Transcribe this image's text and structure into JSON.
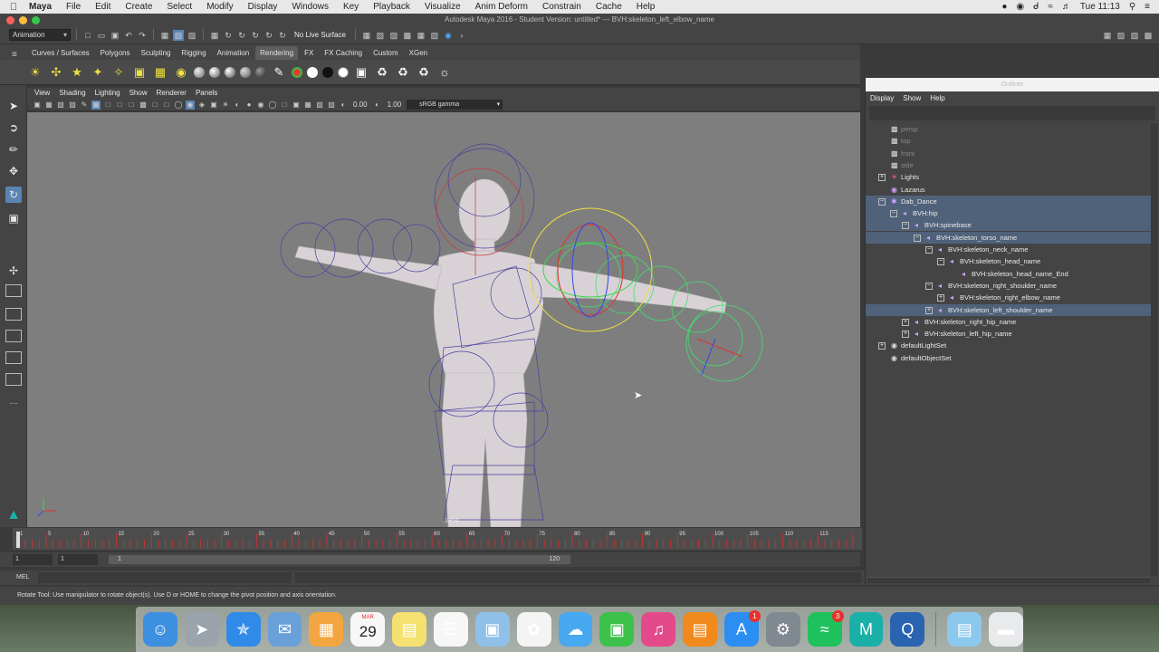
{
  "macbar": {
    "app": "Maya",
    "menus": [
      "File",
      "Edit",
      "Create",
      "Select",
      "Modify",
      "Display",
      "Windows",
      "Key",
      "Playback",
      "Visualize",
      "Anim Deform",
      "Constrain",
      "Cache",
      "Help"
    ],
    "clock": "Tue 11:13"
  },
  "window": {
    "title": "Autodesk Maya 2016 - Student Version: untitled*   ---   BVH:skeleton_left_elbow_name"
  },
  "statusline": {
    "menuset": "Animation",
    "live_surface": "No Live Surface"
  },
  "shelf": {
    "tabs": [
      "Curves / Surfaces",
      "Polygons",
      "Sculpting",
      "Rigging",
      "Animation",
      "Rendering",
      "FX",
      "FX Caching",
      "Custom",
      "XGen"
    ],
    "active_tab": "Rendering"
  },
  "viewport": {
    "menus": [
      "View",
      "Shading",
      "Lighting",
      "Show",
      "Renderer",
      "Panels"
    ],
    "exposure": "0.00",
    "gamma": "1.00",
    "color_space": "sRGB gamma",
    "camera_label": "persp"
  },
  "outliner": {
    "title": "Outliner",
    "menus": [
      "Display",
      "Show",
      "Help"
    ],
    "rows": [
      {
        "label": "persp",
        "depth": 0,
        "expander": "",
        "icon": "camera-icon",
        "dim": true,
        "selected": false
      },
      {
        "label": "top",
        "depth": 0,
        "expander": "",
        "icon": "camera-icon",
        "dim": true,
        "selected": false
      },
      {
        "label": "front",
        "depth": 0,
        "expander": "",
        "icon": "camera-icon",
        "dim": true,
        "selected": false
      },
      {
        "label": "side",
        "depth": 0,
        "expander": "",
        "icon": "camera-icon",
        "dim": true,
        "selected": false
      },
      {
        "label": "Lights",
        "depth": 0,
        "expander": "+",
        "icon": "light-icon",
        "dim": false,
        "selected": false
      },
      {
        "label": "Lazarus",
        "depth": 0,
        "expander": "",
        "icon": "mesh-icon",
        "dim": false,
        "selected": false
      },
      {
        "label": "Dab_Dance",
        "depth": 0,
        "expander": "-",
        "icon": "joint-root-icon",
        "dim": false,
        "selected": true
      },
      {
        "label": "BVH:hip",
        "depth": 1,
        "expander": "-",
        "icon": "joint-icon",
        "dim": false,
        "selected": true
      },
      {
        "label": "BVH:spinebase",
        "depth": 2,
        "expander": "-",
        "icon": "joint-icon",
        "dim": false,
        "selected": true
      },
      {
        "label": "BVH:skeleton_torso_name",
        "depth": 3,
        "expander": "-",
        "icon": "joint-icon",
        "dim": false,
        "selected": true
      },
      {
        "label": "BVH:skeleton_neck_name",
        "depth": 4,
        "expander": "-",
        "icon": "joint-icon",
        "dim": false,
        "selected": false
      },
      {
        "label": "BVH:skeleton_head_name",
        "depth": 5,
        "expander": "-",
        "icon": "joint-icon",
        "dim": false,
        "selected": false
      },
      {
        "label": "BVH:skeleton_head_name_End",
        "depth": 6,
        "expander": "",
        "icon": "joint-icon",
        "dim": false,
        "selected": false
      },
      {
        "label": "BVH:skeleton_right_shoulder_name",
        "depth": 4,
        "expander": "-",
        "icon": "joint-icon",
        "dim": false,
        "selected": false
      },
      {
        "label": "BVH:skeleton_right_elbow_name",
        "depth": 5,
        "expander": "+",
        "icon": "joint-icon",
        "dim": false,
        "selected": false
      },
      {
        "label": "BVH:skeleton_left_shoulder_name",
        "depth": 4,
        "expander": "+",
        "icon": "joint-icon",
        "dim": false,
        "selected": true
      },
      {
        "label": "BVH:skeleton_right_hip_name",
        "depth": 2,
        "expander": "+",
        "icon": "joint-icon",
        "dim": false,
        "selected": false
      },
      {
        "label": "BVH:skeleton_left_hip_name",
        "depth": 2,
        "expander": "+",
        "icon": "joint-icon",
        "dim": false,
        "selected": false
      },
      {
        "label": "defaultLightSet",
        "depth": 0,
        "expander": "+",
        "icon": "set-icon",
        "dim": false,
        "selected": false
      },
      {
        "label": "defaultObjectSet",
        "depth": 0,
        "expander": "",
        "icon": "set-icon",
        "dim": false,
        "selected": false
      }
    ]
  },
  "timeline": {
    "ticks": [
      "1",
      "5",
      "10",
      "15",
      "20",
      "25",
      "30",
      "35",
      "40",
      "45",
      "50",
      "55",
      "60",
      "65",
      "70",
      "75",
      "80",
      "85",
      "90",
      "95",
      "100",
      "105",
      "110",
      "115"
    ],
    "range_start": "1",
    "range_inner_start": "1",
    "range_slider_start": "1",
    "range_slider_end": "120"
  },
  "cmdline": {
    "mel": "MEL"
  },
  "helpline": {
    "text": "Rotate Tool: Use manipulator to rotate object(s). Use D or HOME to change the pivot position and axis orientation."
  },
  "dock": {
    "apps": [
      {
        "name": "Finder",
        "icon": "finder-icon",
        "color": "#3d8fe0",
        "badge": ""
      },
      {
        "name": "Launchpad",
        "icon": "rocket-icon",
        "color": "#9ba3ad",
        "badge": ""
      },
      {
        "name": "Safari",
        "icon": "compass-icon",
        "color": "#2f8ae8",
        "badge": ""
      },
      {
        "name": "Mail",
        "icon": "stamp-icon",
        "color": "#6aa0d8",
        "badge": ""
      },
      {
        "name": "Notes",
        "icon": "notes-icon",
        "color": "#f3a640",
        "badge": ""
      },
      {
        "name": "Calendar",
        "icon": "calendar-icon",
        "color": "#f7f7f7",
        "badge": ""
      },
      {
        "name": "Stickies",
        "icon": "sticky-icon",
        "color": "#f5e170",
        "badge": ""
      },
      {
        "name": "Reminders",
        "icon": "list-icon",
        "color": "#f7f7f7",
        "badge": ""
      },
      {
        "name": "Preview",
        "icon": "photos-stack-icon",
        "color": "#8fc0e8",
        "badge": ""
      },
      {
        "name": "Photos",
        "icon": "flower-icon",
        "color": "#f4f4f4",
        "badge": ""
      },
      {
        "name": "Messages",
        "icon": "chat-bubble-icon",
        "color": "#48a8f0",
        "badge": ""
      },
      {
        "name": "FaceTime",
        "icon": "video-camera-icon",
        "color": "#3cc24a",
        "badge": ""
      },
      {
        "name": "iTunes",
        "icon": "music-note-icon",
        "color": "#e44a8a",
        "badge": ""
      },
      {
        "name": "iBooks",
        "icon": "book-icon",
        "color": "#f08a1c",
        "badge": ""
      },
      {
        "name": "App Store",
        "icon": "app-store-icon",
        "color": "#2c8ef0",
        "badge": "1"
      },
      {
        "name": "System Preferences",
        "icon": "gear-icon",
        "color": "#808890",
        "badge": ""
      },
      {
        "name": "Spotify",
        "icon": "spotify-icon",
        "color": "#1fc15c",
        "badge": "3"
      },
      {
        "name": "Maya",
        "icon": "maya-icon",
        "color": "#1ab0a8",
        "badge": ""
      },
      {
        "name": "QuickTime",
        "icon": "quicktime-icon",
        "color": "#2a64b0",
        "badge": ""
      },
      {
        "name": "Downloads",
        "icon": "folder-icon",
        "color": "#8cc8ee",
        "badge": ""
      },
      {
        "name": "Trash",
        "icon": "trash-icon",
        "color": "#e8eaec",
        "badge": ""
      }
    ],
    "calendar_month": "MAR",
    "calendar_day": "29"
  },
  "colors": {
    "viewport_bg": "#7e7e7e",
    "selection": "#50627a",
    "active_tool": "#5a84b3",
    "timeline_red": "#d0332e",
    "rotate_x": "#e33030",
    "rotate_y": "#3ad84a",
    "rotate_z": "#3248e8",
    "rotate_view": "#f2e040"
  }
}
